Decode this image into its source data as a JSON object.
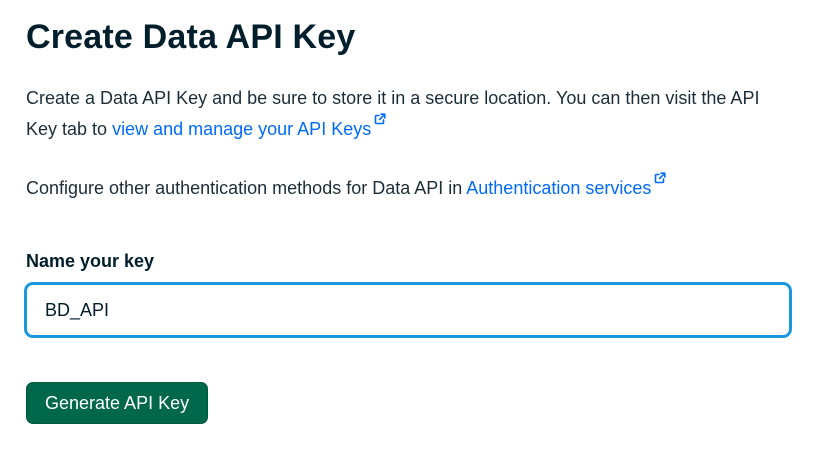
{
  "page": {
    "title": "Create Data API Key"
  },
  "intro": {
    "text_before_link": "Create a Data API Key and be sure to store it in a secure location. You can then visit the API Key tab to ",
    "link_text": "view and manage your API Keys",
    "link_icon": "external-link-icon"
  },
  "auth": {
    "text_before_link": "Configure other authentication methods for Data API in ",
    "link_text": "Authentication services",
    "link_icon": "external-link-icon"
  },
  "key_name": {
    "label": "Name your key",
    "value": "BD_API"
  },
  "actions": {
    "generate_label": "Generate API Key"
  },
  "colors": {
    "link": "#016bf8",
    "input_focus_border": "#1a97dd",
    "primary_button": "#00684a",
    "heading": "#001e2b"
  }
}
